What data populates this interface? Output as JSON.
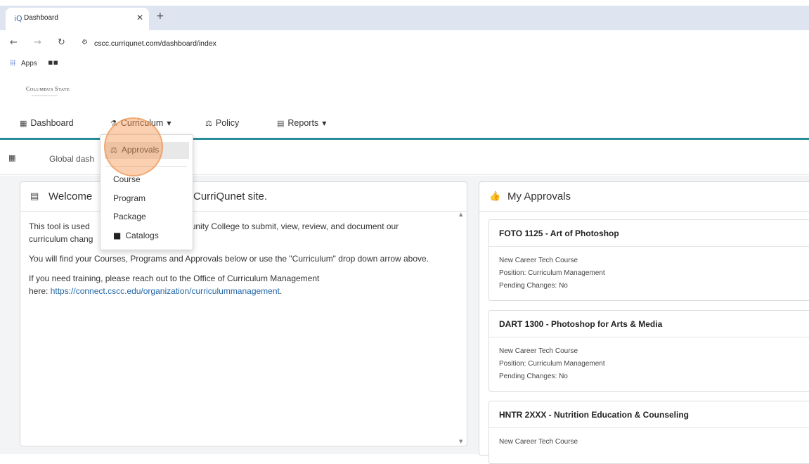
{
  "browser": {
    "tab_title": "Dashboard",
    "tab_favicon": "iQ",
    "url": "cscc.curriqunet.com/dashboard/index",
    "bookmarks": {
      "apps_label": "Apps"
    }
  },
  "site": {
    "logo": "Columbus State"
  },
  "nav": {
    "dashboard": "Dashboard",
    "curriculum": "Curriculum",
    "policy": "Policy",
    "reports": "Reports"
  },
  "subbar": {
    "text": "Global dash"
  },
  "dropdown": {
    "items": [
      "Approvals",
      "Course",
      "Program",
      "Package",
      "Catalogs"
    ]
  },
  "welcome": {
    "title_start": "Welcome",
    "title_end": "CurriQunet site.",
    "para1_start": "This tool is used",
    "para1_end": "mmunity College to submit, view, review, and document our",
    "para1_line2": "curriculum chang",
    "para2": "You will find your Courses, Programs and Approvals below or use the \"Curriculum\" drop down arrow above.",
    "para3": "If you need training, please reach out to the Office of Curriculum Management",
    "para3_here": "here: ",
    "link": "https://connect.cscc.edu/organization/curriculummanagement",
    "link_suffix": "."
  },
  "approvals": {
    "title": "My Approvals",
    "items": [
      {
        "title": "FOTO 1125 - Art of Photoshop",
        "type": "New Career Tech Course",
        "position": "Position: Curriculum Management",
        "pending": "Pending Changes: No"
      },
      {
        "title": "DART 1300 - Photoshop for Arts & Media",
        "type": "New Career Tech Course",
        "position": "Position: Curriculum Management",
        "pending": "Pending Changes: No"
      },
      {
        "title": "HNTR 2XXX - Nutrition Education & Counseling",
        "type": "New Career Tech Course"
      }
    ]
  },
  "icons": {
    "back": "left-arrow-icon",
    "forward": "right-arrow-icon",
    "reload": "reload-icon",
    "accent": "#2a8e99",
    "link_color": "#2468a8",
    "highlight": "#f39650"
  }
}
